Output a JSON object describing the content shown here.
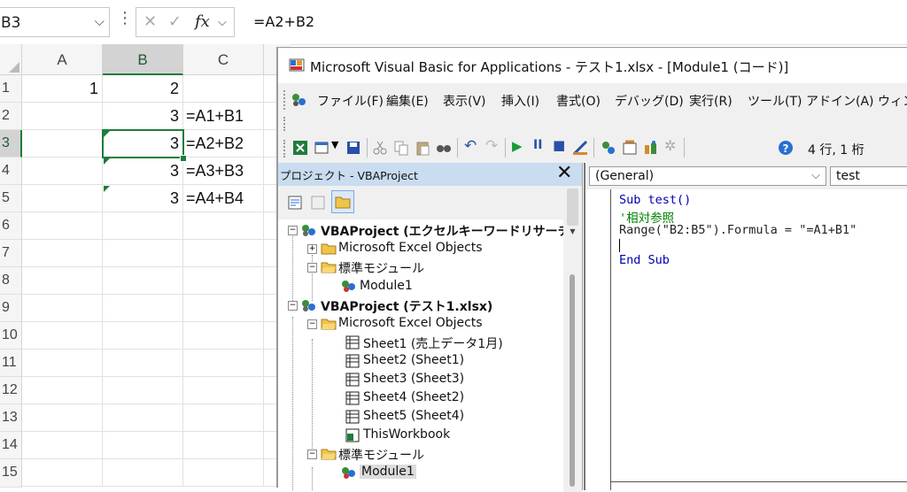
{
  "formula_bar": {
    "name_box": "B3",
    "fx": "fx",
    "formula": "=A2+B2"
  },
  "sheet": {
    "columns": [
      "A",
      "B",
      "C"
    ],
    "rows": [
      "1",
      "2",
      "3",
      "4",
      "5",
      "6",
      "7",
      "8",
      "9",
      "10",
      "11",
      "12",
      "13",
      "14",
      "15"
    ],
    "cells": {
      "A1": "1",
      "B1": "2",
      "B2": "3",
      "C2": "=A1+B1",
      "B3": "3",
      "C3": "=A2+B2",
      "B4": "3",
      "C4": "=A3+B3",
      "B5": "3",
      "C5": "=A4+B4"
    }
  },
  "vbe": {
    "title": "Microsoft Visual Basic for Applications - テスト1.xlsx - [Module1 (コード)]",
    "menu": [
      "ファイル(F)",
      "編集(E)",
      "表示(V)",
      "挿入(I)",
      "書式(O)",
      "デバッグ(D)",
      "実行(R)",
      "ツール(T)",
      "アドイン(A)",
      "ウィン"
    ],
    "status": "4 行, 1 桁",
    "project": {
      "header": "プロジェクト - VBAProject",
      "close": "✕",
      "tree": [
        "VBAProject (エクセルキーワードリサーチ",
        "Microsoft Excel Objects",
        "標準モジュール",
        "Module1",
        "VBAProject (テスト1.xlsx)",
        "Microsoft Excel Objects",
        "Sheet1 (売上データ1月)",
        "Sheet2 (Sheet1)",
        "Sheet3 (Sheet3)",
        "Sheet4 (Sheet2)",
        "Sheet5 (Sheet4)",
        "ThisWorkbook",
        "標準モジュール",
        "Module1"
      ]
    },
    "code": {
      "object_combo": "(General)",
      "proc_combo": "test",
      "lines": [
        "Sub test()",
        "'相対参照",
        "Range(\"B2:B5\").Formula = \"=A1+B1\"",
        "",
        "End Sub"
      ]
    }
  },
  "colors": {
    "excel_green": "#1e7c3c",
    "keyword_blue": "#0000b0",
    "comment_green": "#008000",
    "project_header": "#c9dcf0"
  }
}
